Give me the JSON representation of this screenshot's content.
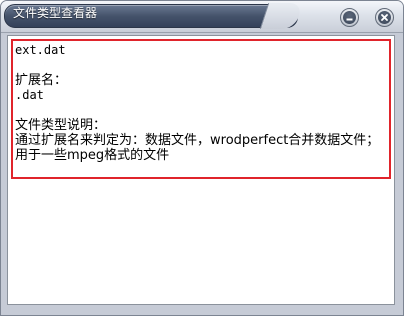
{
  "window": {
    "title": "文件类型查看器"
  },
  "controls": {
    "minimize_icon": "minimize-icon",
    "close_icon": "close-icon"
  },
  "content": {
    "filename": "ext.dat",
    "ext_label": "扩展名：",
    "ext_value": ".dat",
    "desc_label": "文件类型说明：",
    "desc_text": "通过扩展名来判定为：数据文件，wrodperfect合并数据文件；用于一些mpeg格式的文件"
  }
}
